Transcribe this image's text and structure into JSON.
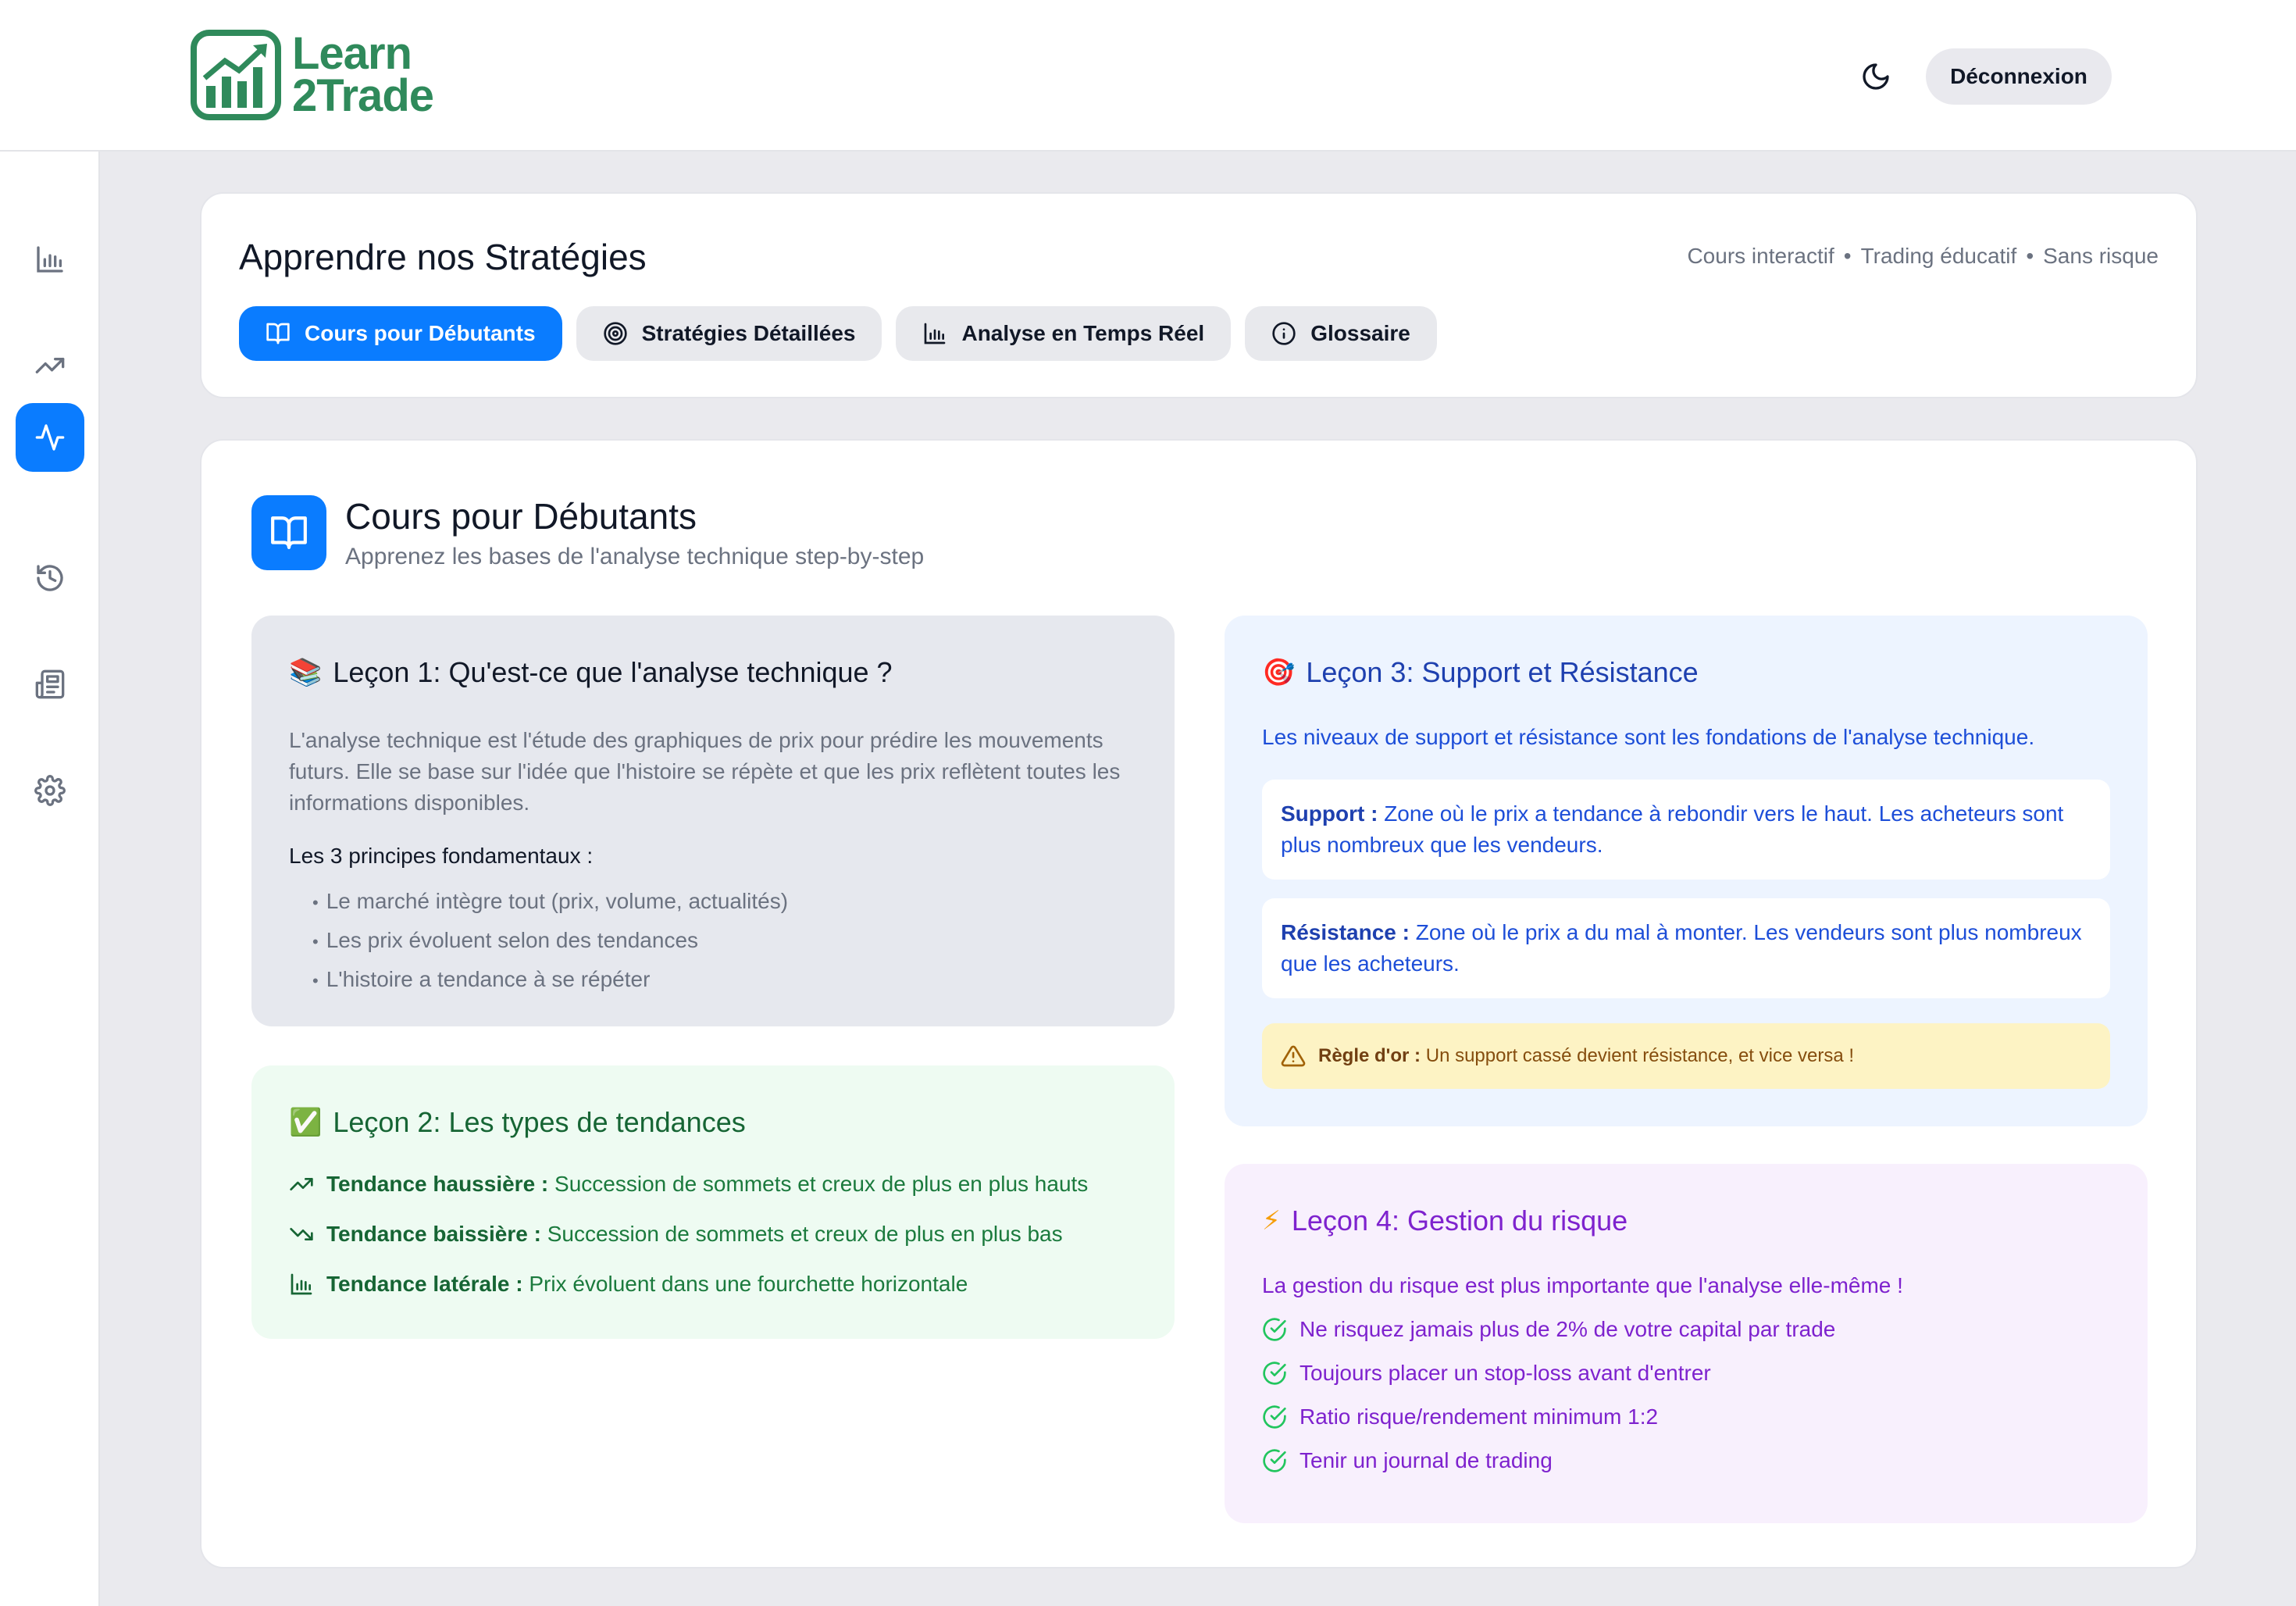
{
  "brand": {
    "line1": "Learn",
    "line2": "2Trade",
    "color": "#2f8a5b"
  },
  "header": {
    "logout_label": "Déconnexion",
    "theme_icon": "moon-icon"
  },
  "sidebar": {
    "items": [
      {
        "name": "bar-chart-icon",
        "active": false
      },
      {
        "name": "trending-up-icon",
        "active": false
      },
      {
        "name": "activity-icon",
        "active": true
      },
      {
        "name": "history-icon",
        "active": false
      },
      {
        "name": "newspaper-icon",
        "active": false
      },
      {
        "name": "settings-icon",
        "active": false
      }
    ]
  },
  "page": {
    "title": "Apprendre nos Stratégies",
    "meta": [
      "Cours interactif",
      "Trading éducatif",
      "Sans risque"
    ],
    "tabs": [
      {
        "label": "Cours pour Débutants",
        "icon": "book-open-icon",
        "active": true
      },
      {
        "label": "Stratégies Détaillées",
        "icon": "target-icon",
        "active": false
      },
      {
        "label": "Analyse en Temps Réel",
        "icon": "bar-chart-icon",
        "active": false
      },
      {
        "label": "Glossaire",
        "icon": "info-icon",
        "active": false
      }
    ]
  },
  "section": {
    "title": "Cours pour Débutants",
    "subtitle": "Apprenez les bases de l'analyse technique step-by-step"
  },
  "lesson1": {
    "emoji": "📚",
    "title": "Leçon 1: Qu'est-ce que l'analyse technique ?",
    "description": "L'analyse technique est l'étude des graphiques de prix pour prédire les mouvements futurs. Elle se base sur l'idée que l'histoire se répète et que les prix reflètent toutes les informations disponibles.",
    "principles_title": "Les 3 principes fondamentaux :",
    "principles": [
      "Le marché intègre tout (prix, volume, actualités)",
      "Les prix évoluent selon des tendances",
      "L'histoire a tendance à se répéter"
    ]
  },
  "lesson2": {
    "emoji": "✅",
    "title": "Leçon 2: Les types de tendances",
    "trends": [
      {
        "label": "Tendance haussière :",
        "text": "Succession de sommets et creux de plus en plus hauts",
        "icon": "trending-up-icon"
      },
      {
        "label": "Tendance baissière :",
        "text": "Succession de sommets et creux de plus en plus bas",
        "icon": "trending-down-icon"
      },
      {
        "label": "Tendance latérale :",
        "text": "Prix évoluent dans une fourchette horizontale",
        "icon": "bar-chart-icon"
      }
    ]
  },
  "lesson3": {
    "emoji": "🎯",
    "title": "Leçon 3: Support et Résistance",
    "intro": "Les niveaux de support et résistance sont les fondations de l'analyse technique.",
    "support_label": "Support :",
    "support_text": "Zone où le prix a tendance à rebondir vers le haut. Les acheteurs sont plus nombreux que les vendeurs.",
    "resistance_label": "Résistance :",
    "resistance_text": "Zone où le prix a du mal à monter. Les vendeurs sont plus nombreux que les acheteurs.",
    "rule_label": "Règle d'or :",
    "rule_text": "Un support cassé devient résistance, et vice versa !"
  },
  "lesson4": {
    "emoji": "⚡",
    "title": "Leçon 4: Gestion du risque",
    "intro": "La gestion du risque est plus importante que l'analyse elle-même !",
    "rules": [
      "Ne risquez jamais plus de 2% de votre capital par trade",
      "Toujours placer un stop-loss avant d'entrer",
      "Ratio risque/rendement minimum 1:2",
      "Tenir un journal de trading"
    ]
  },
  "colors": {
    "accent": "#0a7cff",
    "green": "#166534",
    "blue": "#1e40af",
    "purple": "#7e22ce",
    "warn_bg": "#fdf3c4"
  }
}
